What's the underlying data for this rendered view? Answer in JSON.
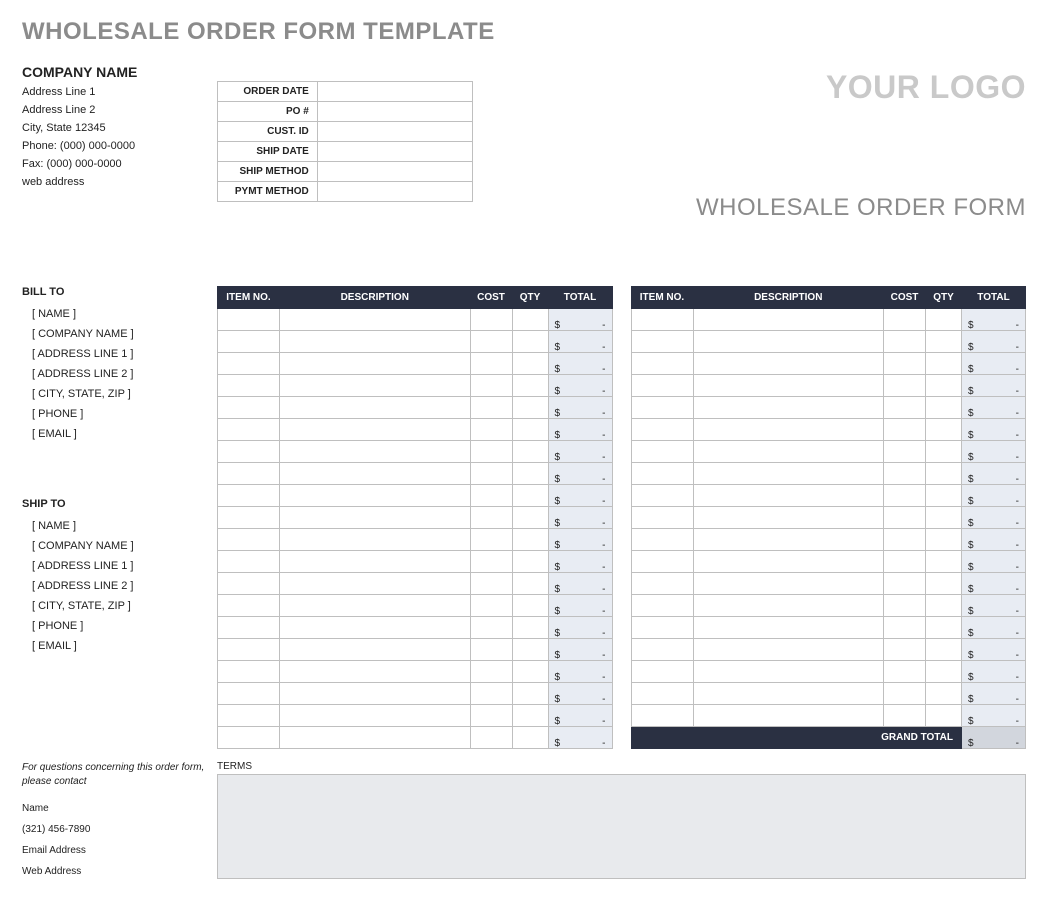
{
  "page_title": "WHOLESALE ORDER FORM TEMPLATE",
  "company": {
    "name": "COMPANY NAME",
    "address1": "Address Line 1",
    "address2": "Address Line 2",
    "city_state_zip": "City, State  12345",
    "phone": "Phone: (000) 000-0000",
    "fax": "Fax: (000) 000-0000",
    "web": "web address"
  },
  "logo_placeholder": "YOUR LOGO",
  "form_name": "WHOLESALE ORDER FORM",
  "meta_rows": [
    {
      "label": "ORDER DATE",
      "value": ""
    },
    {
      "label": "PO #",
      "value": ""
    },
    {
      "label": "CUST. ID",
      "value": ""
    },
    {
      "label": "SHIP DATE",
      "value": ""
    },
    {
      "label": "SHIP METHOD",
      "value": ""
    },
    {
      "label": "PYMT METHOD",
      "value": ""
    }
  ],
  "bill_to": {
    "heading": "BILL TO",
    "name": "[ NAME ]",
    "company": "[ COMPANY NAME ]",
    "address1": "[ ADDRESS LINE 1 ]",
    "address2": "[ ADDRESS LINE 2 ]",
    "city": "[ CITY, STATE, ZIP ]",
    "phone": "[ PHONE ]",
    "email": "[ EMAIL ]"
  },
  "ship_to": {
    "heading": "SHIP TO",
    "name": "[ NAME ]",
    "company": "[ COMPANY NAME ]",
    "address1": "[ ADDRESS LINE 1 ]",
    "address2": "[ ADDRESS LINE 2 ]",
    "city": "[ CITY, STATE, ZIP ]",
    "phone": "[ PHONE ]",
    "email": "[ EMAIL ]"
  },
  "items_header": {
    "item_no": "ITEM NO.",
    "description": "DESCRIPTION",
    "cost": "COST",
    "qty": "QTY",
    "total": "TOTAL"
  },
  "currency_symbol": "$",
  "dash": "-",
  "left_rows": 20,
  "right_rows": 19,
  "grand_total_label": "GRAND TOTAL",
  "terms_label": "TERMS",
  "terms_text": "",
  "contact": {
    "intro": "For questions concerning this order form, please contact",
    "name": "Name",
    "phone": "(321) 456-7890",
    "email": "Email Address",
    "web": "Web Address"
  }
}
